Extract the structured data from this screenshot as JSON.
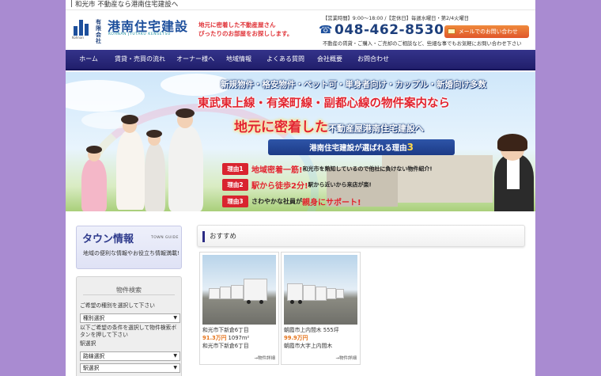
{
  "topbar": {
    "text": "和光市 不動産なら港南住宅建設へ"
  },
  "header": {
    "logo_kana": "Kohnan",
    "company_type": "有限会社",
    "company_name": "港南住宅建設",
    "company_romaji": "KOHNAN JYUTAKU KENSETSU",
    "catch_line1": "地元に密着した不動産屋さん",
    "catch_line2": "ぴったりのお部屋をお探しします。",
    "hours": "【営業時間】9:00～18:00 /【定休日】毎週水曜日・第2/4火曜日",
    "tel": "048-462-8530",
    "mail_button": "メールでのお問い合わせ",
    "note": "不動産の賃貸・ご購入・ご売却のご相談など、些細な事でもお気軽にお問い合わせ下さい"
  },
  "nav": [
    "ホーム",
    "賃貸・売買の流れ",
    "オーナー様へ",
    "地域情報",
    "よくある質問",
    "会社概要",
    "お問合わせ"
  ],
  "hero": {
    "line1": "新規物件・格安物件・ペット可・単身者向け・カップル・新婚向け多数",
    "line2": "東武東上線・有楽町線・副都心線の物件案内なら",
    "line3_big": "地元に密着した",
    "line3_small": "不動産屋港南住宅建設へ",
    "reason_title": "港南住宅建設が選ばれる理由",
    "reason_count": "3",
    "reasons": [
      {
        "tag": "理由1",
        "pre": "",
        "main": "地域密着一筋!",
        "desc": "和光市を熟知しているので他社に負けない物件紹介!"
      },
      {
        "tag": "理由2",
        "pre": "",
        "main": "駅から徒歩2分!",
        "desc": "駅から近いから来店が楽!"
      },
      {
        "tag": "理由3",
        "pre": "さわやかな社員が",
        "main": "親身にサポート!",
        "desc": ""
      }
    ]
  },
  "sidebar": {
    "town_guide": {
      "title": "タウン情報",
      "title_en": "TOWN GUIDE",
      "desc": "地域の便利な情報やお役立ち情報満載!"
    },
    "search": {
      "title": "物件検索",
      "type_prompt": "ご希望の種別を選択して下さい",
      "type_select": "種別選択",
      "cond_prompt": "以下ご希望の条件を選択して物件検索ボタンを押して下さい",
      "station_label": "駅選択",
      "route_select": "路線選択",
      "station_select": "駅選択"
    }
  },
  "main": {
    "section_title": "おすすめ",
    "cards": [
      {
        "location": "和光市下新倉6丁目",
        "price": "91.3万円",
        "area": "1097m²",
        "address": "和光市下新倉6丁目",
        "more": "→物件詳細"
      },
      {
        "location": "朝霞市上内間木 555坪",
        "price": "99.9万円",
        "area": "",
        "address": "朝霞市大字上内間木",
        "more": "→物件詳細"
      }
    ]
  },
  "colors": {
    "background": "#a98bd1",
    "nav": "#2a2878",
    "accent_red": "#e2242f",
    "accent_orange": "#e5731a",
    "brand_blue": "#1d4f9c"
  }
}
